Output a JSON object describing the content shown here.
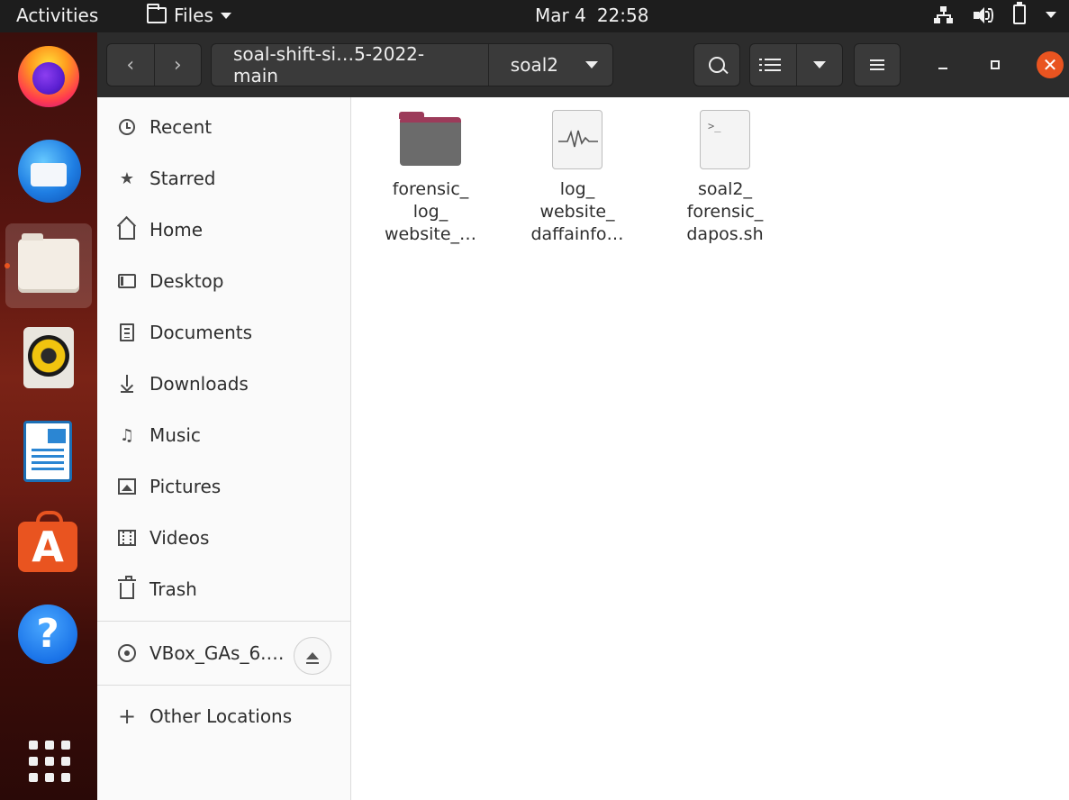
{
  "topbar": {
    "activities_label": "Activities",
    "app_name": "Files",
    "date": "Mar 4",
    "time": "22:58"
  },
  "dock": {
    "apps": [
      {
        "name": "firefox-icon"
      },
      {
        "name": "thunderbird-icon"
      },
      {
        "name": "files-icon",
        "running": true,
        "active": true
      },
      {
        "name": "rhythmbox-icon"
      },
      {
        "name": "libreoffice-writer-icon"
      },
      {
        "name": "ubuntu-software-icon",
        "glyph": "A"
      },
      {
        "name": "help-icon",
        "glyph": "?"
      },
      {
        "name": "show-applications-icon"
      }
    ]
  },
  "headerbar": {
    "back_glyph": "‹",
    "forward_glyph": "›",
    "path_parent": "soal-shift-si…5-2022-main",
    "path_current": "soal2",
    "close_glyph": "✕"
  },
  "sidebar": {
    "items": [
      {
        "label": "Recent",
        "icon": "clock-icon"
      },
      {
        "label": "Starred",
        "icon": "star-icon",
        "glyph": "★"
      },
      {
        "label": "Home",
        "icon": "home-icon"
      },
      {
        "label": "Desktop",
        "icon": "desktop-icon"
      },
      {
        "label": "Documents",
        "icon": "document-icon"
      },
      {
        "label": "Downloads",
        "icon": "download-icon"
      },
      {
        "label": "Music",
        "icon": "music-note-icon",
        "glyph": "♫"
      },
      {
        "label": "Pictures",
        "icon": "picture-icon"
      },
      {
        "label": "Videos",
        "icon": "film-icon"
      },
      {
        "label": "Trash",
        "icon": "trash-icon"
      }
    ],
    "device": {
      "label": "VBox_GAs_6.…",
      "icon": "disc-icon"
    },
    "other_locations": {
      "label": "Other Locations",
      "glyph": "+"
    }
  },
  "files": [
    {
      "lines": [
        "forensic_",
        "log_",
        "website_…"
      ],
      "type": "folder",
      "icon": "folder-icon"
    },
    {
      "lines": [
        "log_",
        "website_",
        "daffainfo…"
      ],
      "type": "log",
      "icon": "log-file-icon"
    },
    {
      "lines": [
        "soal2_",
        "forensic_",
        "dapos.sh"
      ],
      "type": "script",
      "icon": "shell-script-icon",
      "prompt": ">_"
    }
  ]
}
